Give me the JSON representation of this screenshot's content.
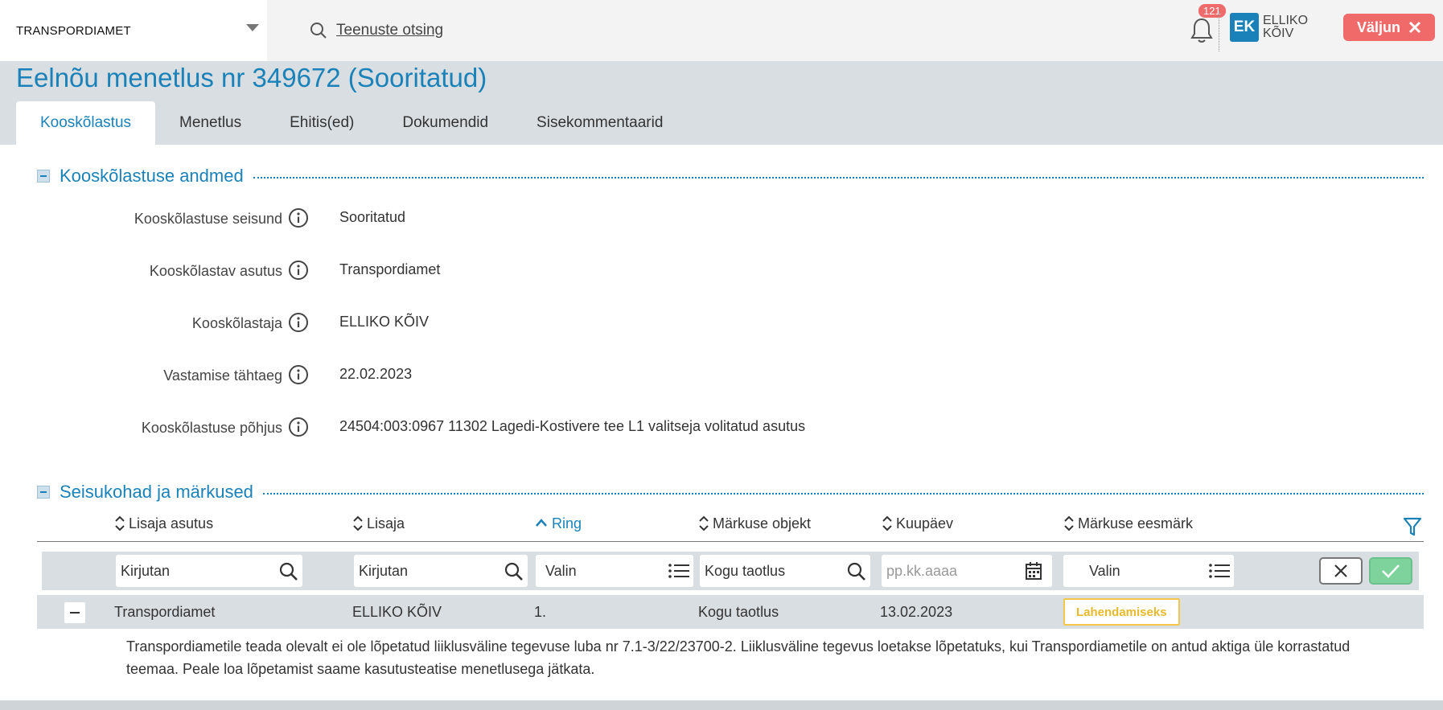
{
  "topbar": {
    "org": "TRANSPORDIAMET",
    "search_label": "Teenuste otsing",
    "notifications_count": "121",
    "avatar_initials": "EK",
    "user_first": "ELLIKO",
    "user_last": "KÕIV",
    "logout_label": "Väljun"
  },
  "page": {
    "title": "Eelnõu menetlus nr 349672 (Sooritatud)"
  },
  "tabs": [
    {
      "label": "Kooskõlastus",
      "active": true
    },
    {
      "label": "Menetlus"
    },
    {
      "label": "Ehitis(ed)"
    },
    {
      "label": "Dokumendid"
    },
    {
      "label": "Sisekommentaarid"
    }
  ],
  "section1": {
    "title": "Kooskõlastuse andmed",
    "fields": [
      {
        "label": "Kooskõlastuse seisund",
        "value": "Sooritatud"
      },
      {
        "label": "Kooskõlastav asutus",
        "value": "Transpordiamet"
      },
      {
        "label": "Kooskõlastaja",
        "value": "ELLIKO KÕIV"
      },
      {
        "label": "Vastamise tähtaeg",
        "value": "22.02.2023"
      },
      {
        "label": "Kooskõlastuse põhjus",
        "value": "24504:003:0967 11302 Lagedi-Kostivere tee L1 valitseja volitatud asutus"
      }
    ]
  },
  "section2": {
    "title": "Seisukohad ja märkused",
    "columns": [
      "Lisaja asutus",
      "Lisaja",
      "Ring",
      "Märkuse objekt",
      "Kuupäev",
      "Märkuse eesmärk"
    ],
    "filters": {
      "f1": "Kirjutan",
      "f2": "Kirjutan",
      "f3": "Valin",
      "f4": "Kogu taotlus",
      "f5": "pp.kk.aaaa",
      "f6": "Valin"
    },
    "row": {
      "asutus": "Transpordiamet",
      "lisaja": "ELLIKO KÕIV",
      "ring": "1.",
      "objekt": "Kogu taotlus",
      "kuupaev": "13.02.2023",
      "eesmark": "Lahendamiseks"
    },
    "comment": "Transpordiametile teada olevalt ei ole lõpetatud liiklusväline tegevuse luba nr 7.1-3/22/23700-2. Liiklusväline tegevus loetakse lõpetatuks, kui Transpordiametile on antud aktiga üle korrastatud teemaa. Peale loa lõpetamist saame kasutusteatise menetlusega jätkata."
  },
  "colors": {
    "accent": "#1a82b8",
    "danger": "#f06a6a",
    "warning": "#f3c84a",
    "success": "#7ed39c"
  }
}
